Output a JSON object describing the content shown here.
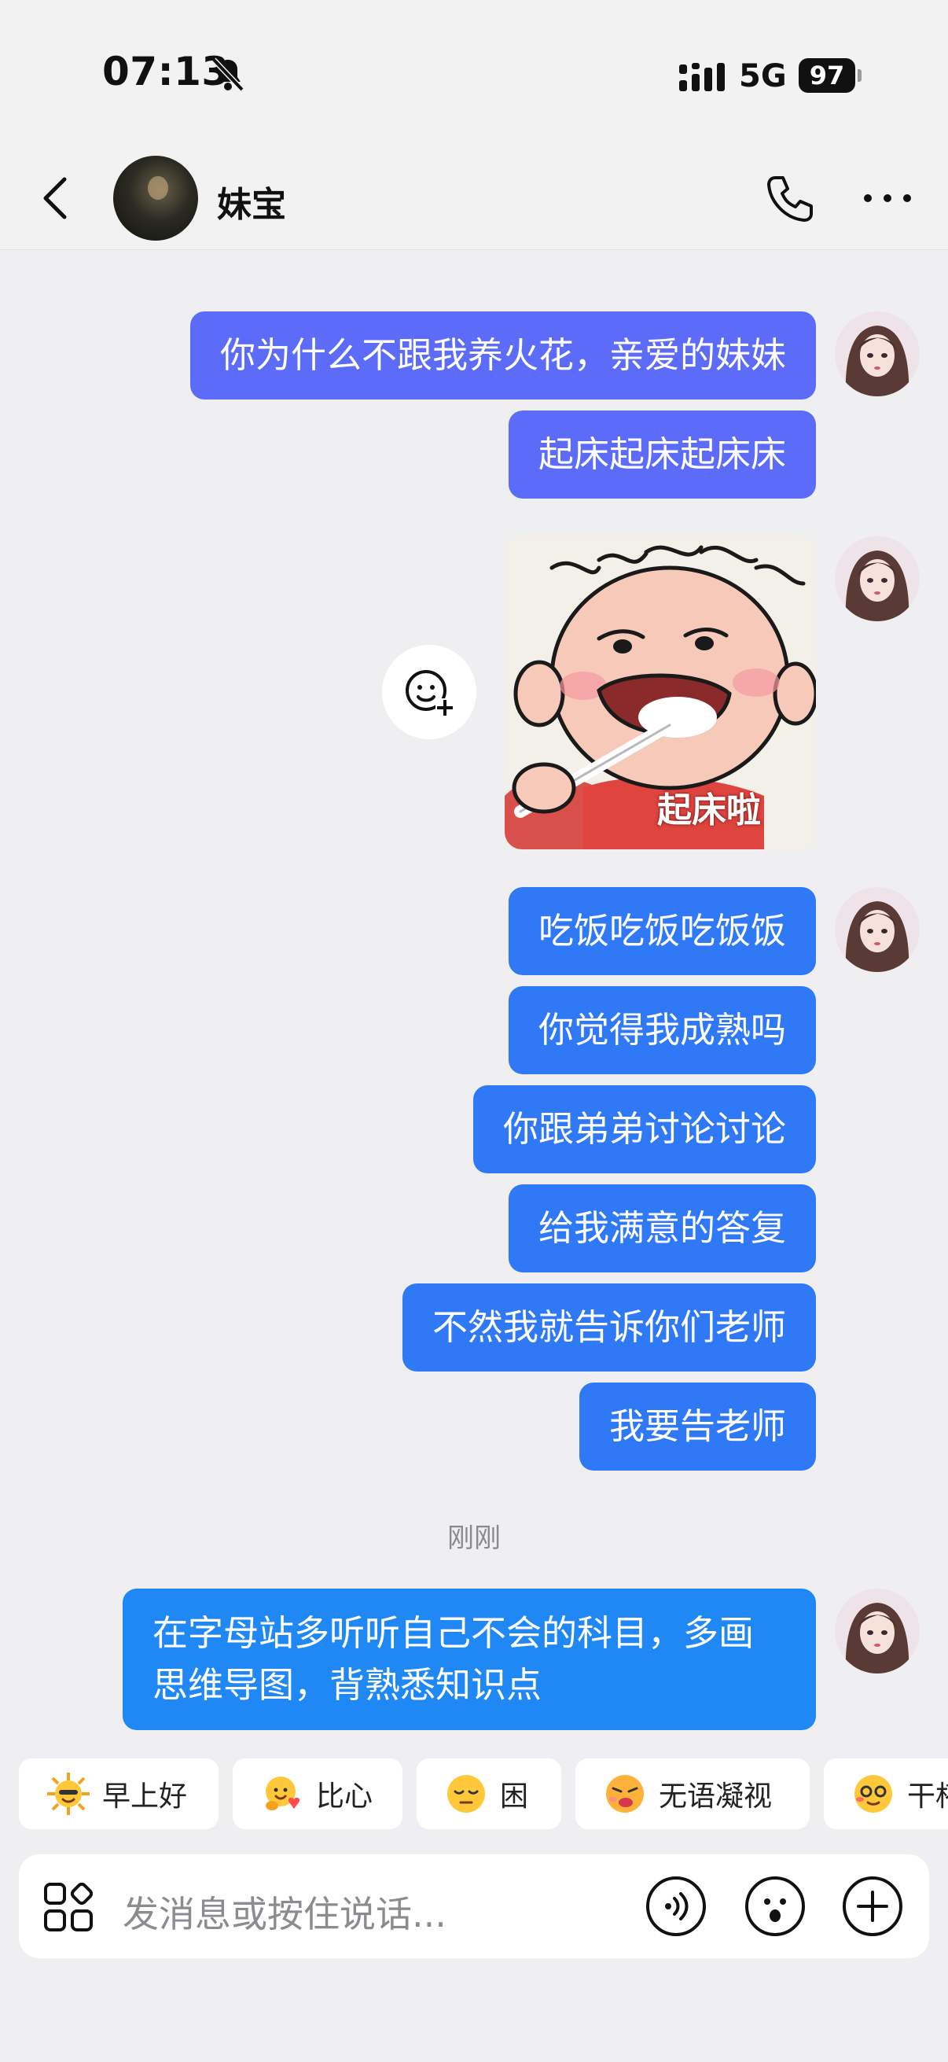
{
  "status_bar": {
    "time": "07:13",
    "network": "5G",
    "battery": "97",
    "icons": [
      "bell-slash-icon",
      "signal-icon"
    ]
  },
  "header": {
    "contact_name": "妹宝",
    "icons": [
      "back-arrow-icon",
      "phone-icon",
      "more-icon"
    ]
  },
  "messages_top": [
    {
      "text": "你为什么不跟我养火花，亲爱的妹妹"
    },
    {
      "text": "起床起床起床床"
    }
  ],
  "sticker": {
    "caption": "起床啦",
    "add_icon": "add-sticker-icon"
  },
  "messages_mid": [
    {
      "text": "吃饭吃饭吃饭饭"
    },
    {
      "text": "你觉得我成熟吗"
    },
    {
      "text": "你跟弟弟讨论讨论"
    },
    {
      "text": "给我满意的答复"
    },
    {
      "text": "不然我就告诉你们老师"
    },
    {
      "text": "我要告老师"
    }
  ],
  "timestamp": "刚刚",
  "last_message": {
    "text": "在字母站多听听自己不会的科目，多画思维导图，背熟悉知识点"
  },
  "quick_replies": [
    {
      "label": "早上好",
      "icon": "sun-emoji-icon"
    },
    {
      "label": "比心",
      "icon": "heart-hands-emoji-icon"
    },
    {
      "label": "困",
      "icon": "sleepy-emoji-icon"
    },
    {
      "label": "无语凝视",
      "icon": "speechless-emoji-icon"
    },
    {
      "label": "干杯",
      "icon": "cheers-emoji-icon"
    }
  ],
  "input": {
    "placeholder": "发消息或按住说话...",
    "icons": [
      "apps-icon",
      "voice-icon",
      "emoji-icon",
      "plus-icon"
    ]
  }
}
